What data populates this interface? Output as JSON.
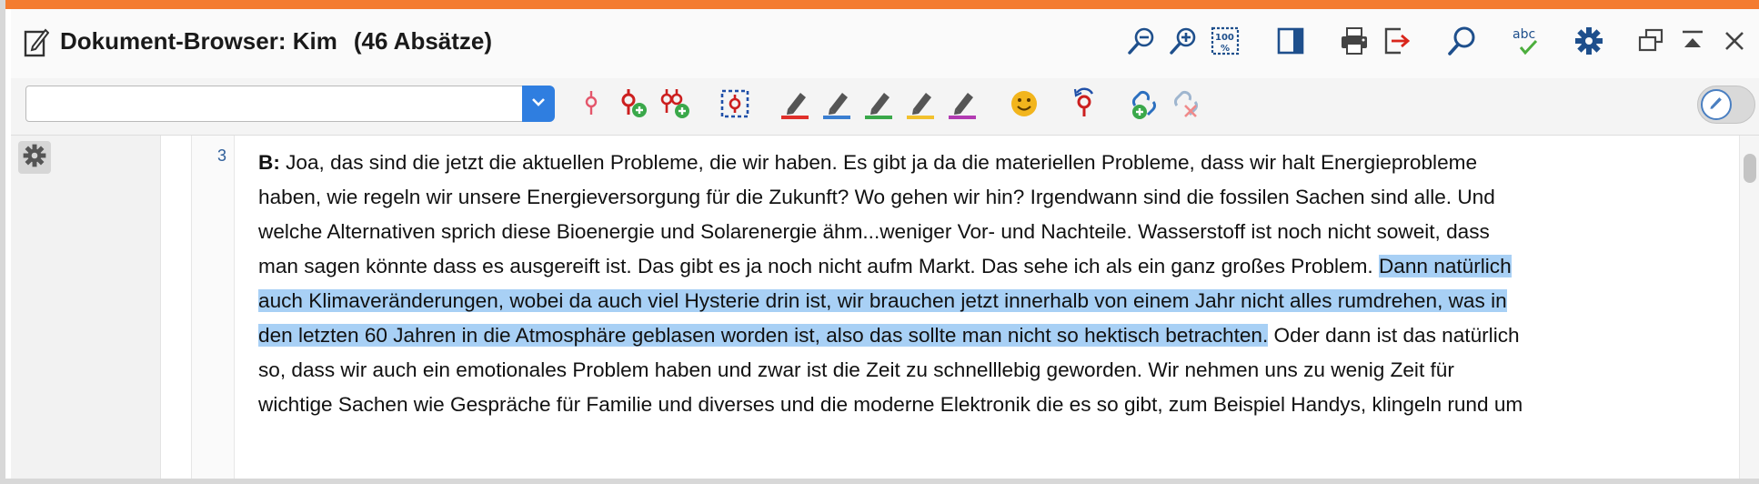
{
  "window": {
    "title": "Dokument-Browser: Kim",
    "count": "(46 Absätze)",
    "accent_color": "#f47c30"
  },
  "title_buttons": [
    {
      "name": "zoom-out-icon"
    },
    {
      "name": "zoom-in-icon"
    },
    {
      "name": "zoom-100-icon"
    },
    {
      "name": "panel-toggle-icon"
    },
    {
      "name": "print-icon"
    },
    {
      "name": "export-icon"
    },
    {
      "name": "search-icon"
    },
    {
      "name": "spellcheck-icon",
      "label": "abc"
    },
    {
      "name": "settings-gear-icon"
    },
    {
      "name": "undock-window-icon"
    },
    {
      "name": "collapse-up-icon"
    },
    {
      "name": "close-icon"
    }
  ],
  "search": {
    "value": "",
    "placeholder": ""
  },
  "coding_tools": [
    {
      "name": "code-marker-icon",
      "color": "#e4566b"
    },
    {
      "name": "add-code-icon",
      "color": "#cc1f1f"
    },
    {
      "name": "add-multiple-codes-icon",
      "color": "#cc1f1f"
    },
    {
      "name": "code-selection-icon",
      "color": "#1f4fa8"
    },
    {
      "name": "highlight-red-icon",
      "color": "#e0302b"
    },
    {
      "name": "highlight-blue-icon",
      "color": "#3b7fd1"
    },
    {
      "name": "highlight-green-icon",
      "color": "#3aa84a"
    },
    {
      "name": "highlight-yellow-icon",
      "color": "#f2c12e"
    },
    {
      "name": "highlight-purple-icon",
      "color": "#b23bb2"
    },
    {
      "name": "emoticon-icon",
      "color": "#f2b51d"
    },
    {
      "name": "recent-code-icon",
      "color": "#cc1f1f"
    },
    {
      "name": "add-link-icon",
      "color": "#2b6fbf"
    },
    {
      "name": "remove-link-icon",
      "color": "#9fb6cf"
    }
  ],
  "paragraph": {
    "number": "3",
    "speaker": "B:",
    "highlight_color": "#a8d0f5",
    "lines": [
      [
        {
          "text": " Joa, das sind die jetzt die aktuellen Probleme, die wir haben. Es gibt ja da die materiellen Probleme, dass wir halt Energieprobleme",
          "hl": false
        }
      ],
      [
        {
          "text": "haben, wie regeln wir unsere Energieversorgung für die Zukunft? Wo gehen wir hin? Irgendwann sind die fossilen Sachen sind alle. Und",
          "hl": false
        }
      ],
      [
        {
          "text": "welche Alternativen sprich diese Bioenergie und Solarenergie ähm...weniger Vor- und Nachteile. Wasserstoff ist noch nicht soweit, dass",
          "hl": false
        }
      ],
      [
        {
          "text": "man sagen könnte dass es ausgereift ist. Das gibt es ja noch nicht aufm Markt. Das sehe ich als ein ganz großes Problem. ",
          "hl": false
        },
        {
          "text": "Dann natürlich",
          "hl": true
        }
      ],
      [
        {
          "text": "auch Klimaveränderungen, wobei da auch viel Hysterie drin ist, wir brauchen jetzt innerhalb von einem Jahr nicht alles rumdrehen, was in",
          "hl": true
        }
      ],
      [
        {
          "text": "den letzten 60 Jahren in die Atmosphäre geblasen worden ist, also das sollte man nicht so hektisch betrachten.",
          "hl": true
        },
        {
          "text": " Oder dann ist das natürlich",
          "hl": false
        }
      ],
      [
        {
          "text": "so, dass wir auch ein emotionales Problem haben und zwar ist die Zeit zu schnelllebig geworden. Wir nehmen uns zu wenig Zeit für",
          "hl": false
        }
      ],
      [
        {
          "text": "wichtige Sachen wie Gespräche für Familie und diverses und die moderne Elektronik die es so gibt, zum Beispiel Handys, klingeln rund um",
          "hl": false
        }
      ]
    ]
  }
}
